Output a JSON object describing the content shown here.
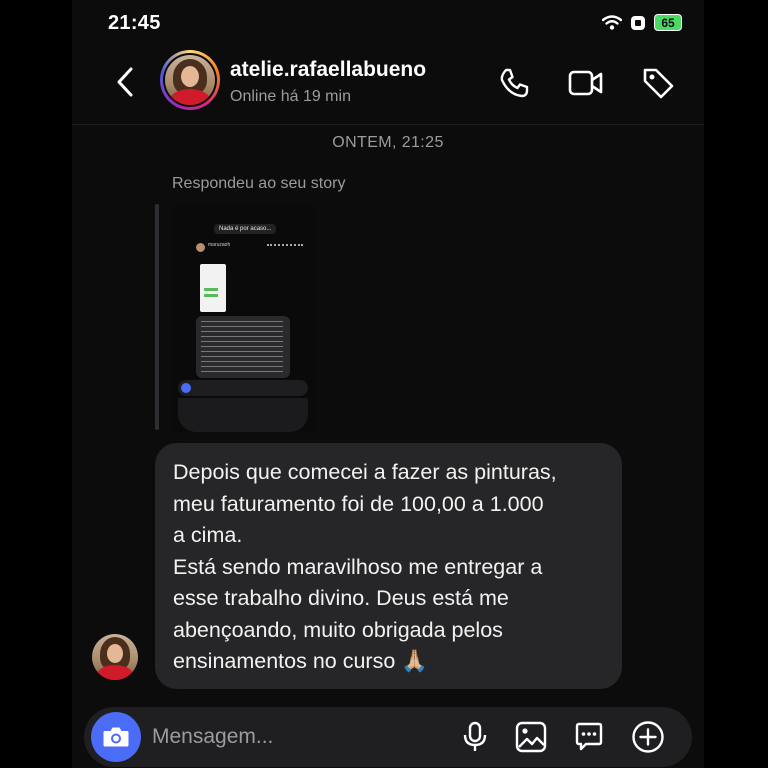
{
  "status_bar": {
    "time": "21:45",
    "battery": "65"
  },
  "header": {
    "username": "atelie.rafaellabueno",
    "presence": "Online há 19 min"
  },
  "thread": {
    "date_separator": "ONTEM, 21:25",
    "reply_label": "Respondeu ao seu story",
    "story_preview": {
      "caption": "Nada é por acaso...",
      "name": "maruzaoh"
    },
    "message_lines": [
      "Depois que comecei a fazer as pinturas,",
      "meu faturamento foi de 100,00 a 1.000",
      "a cima.",
      "Está sendo maravilhoso me entregar a",
      "esse trabalho divino. Deus está me",
      "abençoando, muito obrigada pelos",
      "ensinamentos no curso 🙏🏼"
    ]
  },
  "composer": {
    "placeholder": "Mensagem..."
  },
  "colors": {
    "accent": "#4a6cf7",
    "bubble": "#262628",
    "background": "#0c0c0d",
    "battery": "#4cd964"
  }
}
